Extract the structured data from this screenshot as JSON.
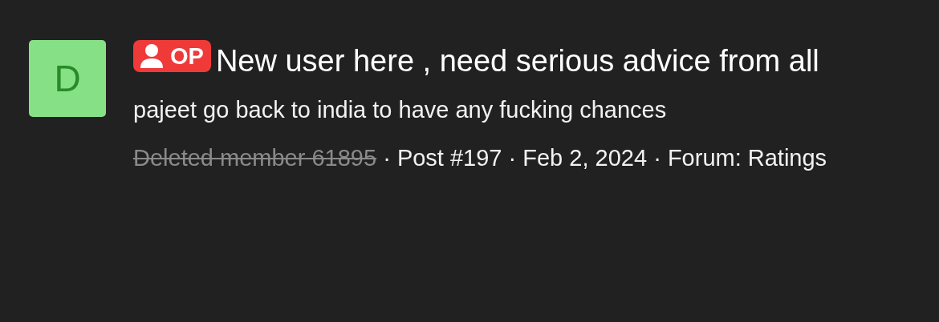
{
  "avatar": {
    "letter": "D",
    "color": "#86e086"
  },
  "badge": {
    "label": "OP"
  },
  "title": "New user here , need serious advice from all",
  "message": "pajeet go back to india to have any fucking chances",
  "author": {
    "name": "Deleted member 61895",
    "deleted": true
  },
  "meta": [
    {
      "separator": "·",
      "text": "Post #197"
    },
    {
      "separator": "·",
      "text": "Feb 2, 2024"
    },
    {
      "separator": "·",
      "text": "Forum: Ratings"
    }
  ]
}
